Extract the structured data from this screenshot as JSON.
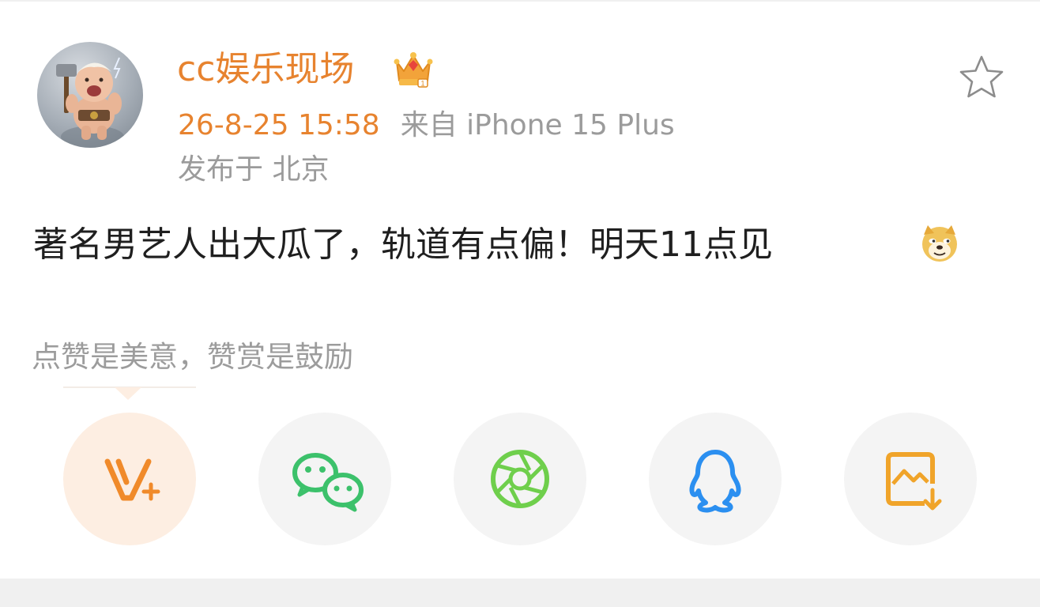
{
  "post": {
    "username": "cc娱乐现场",
    "time": "26-8-25 15:58",
    "source": "来自 iPhone 15 Plus",
    "location": "发布于 北京",
    "text": "著名男艺人出大瓜了，轨道有点偏！明天11点见"
  },
  "reward": {
    "tip": "点赞是美意，赞赏是鼓励"
  },
  "icons": {
    "crown": "crown-icon",
    "favorite": "star-outline-icon",
    "emoji": "doge-emoji-icon",
    "share": [
      "vplus-icon",
      "wechat-icon",
      "moments-icon",
      "qq-icon",
      "save-image-icon"
    ]
  },
  "colors": {
    "accent": "#e7832f",
    "meta_gray": "#9b9b9b",
    "wechat": "#3cc16b",
    "moments": "#6fcf4c",
    "qq": "#2b8ff0",
    "save": "#f0a42a"
  }
}
